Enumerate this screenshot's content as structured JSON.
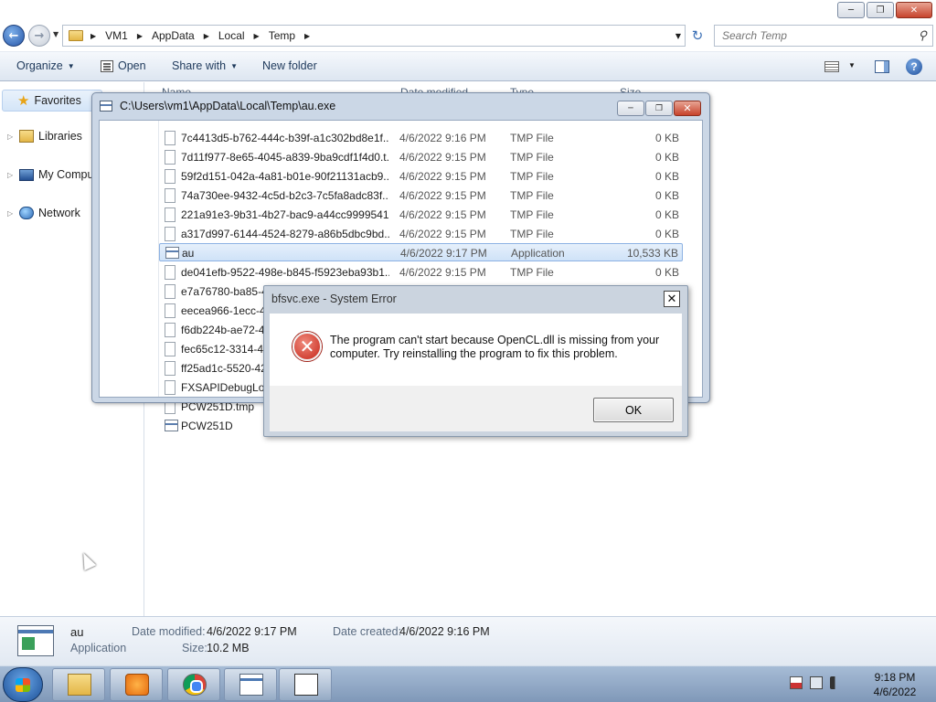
{
  "address": {
    "crumbs": [
      "VM1",
      "AppData",
      "Local",
      "Temp"
    ],
    "search_placeholder": "Search Temp"
  },
  "toolbar": {
    "organize": "Organize",
    "open": "Open",
    "share_with": "Share with",
    "new_folder": "New folder"
  },
  "nav": {
    "favorites": "Favorites",
    "libraries": "Libraries",
    "my_computer": "My Computer",
    "network": "Network"
  },
  "columns": {
    "name": "Name",
    "date_modified": "Date modified",
    "type": "Type",
    "size": "Size"
  },
  "files": [
    {
      "name": "7c4413d5-b762-444c-b39f-a1c302bd8e1f....",
      "date": "4/6/2022 9:16 PM",
      "type": "TMP File",
      "size": "0 KB"
    },
    {
      "name": "7d11f977-8e65-4045-a839-9ba9cdf1f4d0.t...",
      "date": "4/6/2022 9:15 PM",
      "type": "TMP File",
      "size": "0 KB"
    },
    {
      "name": "59f2d151-042a-4a81-b01e-90f21131acb9....",
      "date": "4/6/2022 9:15 PM",
      "type": "TMP File",
      "size": "0 KB"
    },
    {
      "name": "74a730ee-9432-4c5d-b2c3-7c5fa8adc83f....",
      "date": "4/6/2022 9:15 PM",
      "type": "TMP File",
      "size": "0 KB"
    },
    {
      "name": "221a91e3-9b31-4b27-bac9-a44cc9999541....",
      "date": "4/6/2022 9:15 PM",
      "type": "TMP File",
      "size": "0 KB"
    },
    {
      "name": "a317d997-6144-4524-8279-a86b5dbc9bd....",
      "date": "4/6/2022 9:15 PM",
      "type": "TMP File",
      "size": "0 KB"
    },
    {
      "name": "au",
      "date": "4/6/2022 9:17 PM",
      "type": "Application",
      "size": "10,533 KB"
    },
    {
      "name": "de041efb-9522-498e-b845-f5923eba93b1....",
      "date": "4/6/2022 9:15 PM",
      "type": "TMP File",
      "size": "0 KB"
    },
    {
      "name": "e7a76780-ba85-4",
      "date": "",
      "type": "",
      "size": ""
    },
    {
      "name": "eecea966-1ecc-4",
      "date": "",
      "type": "",
      "size": ""
    },
    {
      "name": "f6db224b-ae72-4",
      "date": "",
      "type": "",
      "size": ""
    },
    {
      "name": "fec65c12-3314-48",
      "date": "",
      "type": "",
      "size": ""
    },
    {
      "name": "ff25ad1c-5520-42",
      "date": "",
      "type": "",
      "size": ""
    },
    {
      "name": "FXSAPIDebugLog",
      "date": "",
      "type": "",
      "size": ""
    },
    {
      "name": "PCW251D.tmp",
      "date": "",
      "type": "",
      "size": ""
    },
    {
      "name": "PCW251D",
      "date": "",
      "type": "",
      "size": ""
    }
  ],
  "properties_window": {
    "title": "C:\\Users\\vm1\\AppData\\Local\\Temp\\au.exe"
  },
  "error_dialog": {
    "title": "bfsvc.exe - System Error",
    "message": "The program can't start because OpenCL.dll is missing from your computer. Try reinstalling the program to fix this problem.",
    "ok": "OK"
  },
  "details": {
    "name": "au",
    "kind": "Application",
    "date_modified_label": "Date modified:",
    "date_modified": "4/6/2022 9:17 PM",
    "date_created_label": "Date created:",
    "date_created": "4/6/2022 9:16 PM",
    "size_label": "Size:",
    "size": "10.2 MB"
  },
  "taskbar": {
    "time": "9:18 PM",
    "date": "4/6/2022"
  }
}
